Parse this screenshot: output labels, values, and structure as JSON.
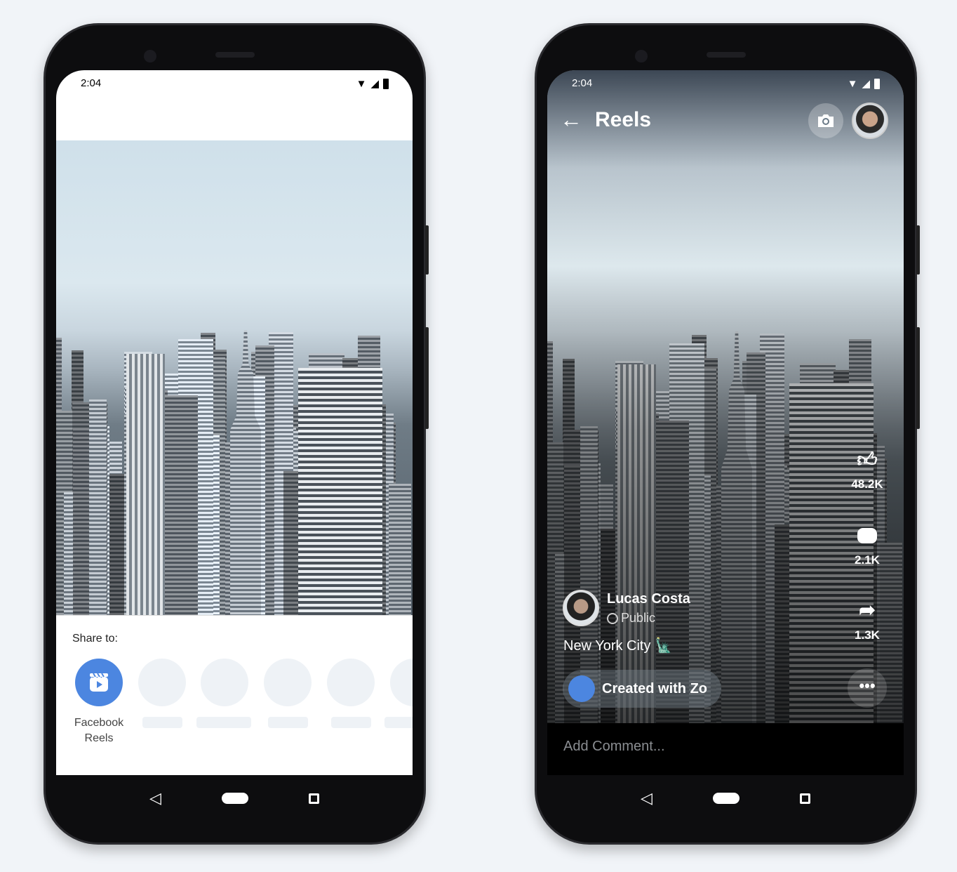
{
  "left_phone": {
    "time": "2:04",
    "share": {
      "title": "Share to:",
      "target_label_line1": "Facebook",
      "target_label_line2": "Reels"
    }
  },
  "right_phone": {
    "time": "2:04",
    "header": {
      "title": "Reels"
    },
    "actions": {
      "likes": "48.2K",
      "comments": "2.1K",
      "shares": "1.3K"
    },
    "author": {
      "name": "Lucas Costa",
      "privacy": "Public"
    },
    "caption": "New York City 🗽",
    "effect": "Created with Zo",
    "comment_placeholder": "Add Comment..."
  },
  "colors": {
    "accent": "#4c86e0",
    "background": "#f1f4f8"
  }
}
